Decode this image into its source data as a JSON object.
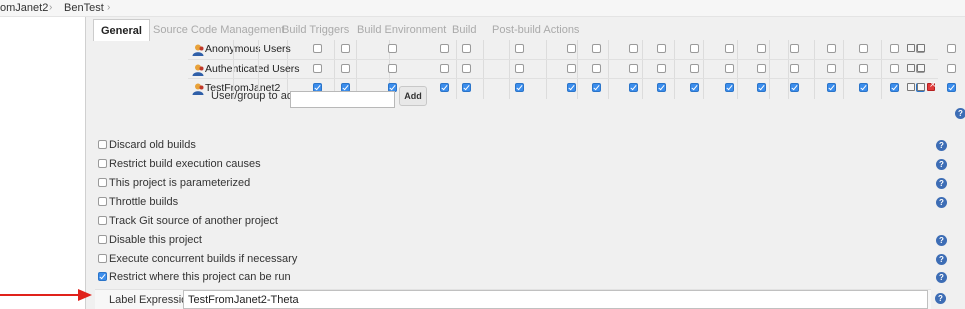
{
  "breadcrumb": {
    "items": [
      "omJanet2",
      "BenTest"
    ],
    "separator": "›"
  },
  "tabs": [
    {
      "label": "General",
      "active": true
    },
    {
      "label": "Source Code Management",
      "active": false
    },
    {
      "label": "Build Triggers",
      "active": false
    },
    {
      "label": "Build Environment",
      "active": false
    },
    {
      "label": "Build",
      "active": false
    },
    {
      "label": "Post-build Actions",
      "active": false
    }
  ],
  "permissions": {
    "rows": [
      {
        "name": "Anonymous Users",
        "checked": [
          false,
          false,
          false,
          false,
          false,
          false,
          false,
          false,
          false,
          false,
          false,
          false,
          false,
          false,
          false,
          false,
          false,
          false,
          false,
          false
        ],
        "actions": [
          "select-all-icon",
          "unselect-all-icon"
        ]
      },
      {
        "name": "Authenticated Users",
        "checked": [
          false,
          false,
          false,
          false,
          false,
          false,
          false,
          false,
          false,
          false,
          false,
          false,
          false,
          false,
          false,
          false,
          false,
          false,
          false,
          false
        ],
        "actions": [
          "select-all-icon",
          "unselect-all-icon"
        ]
      },
      {
        "name": "TestFromJanet2",
        "checked": [
          true,
          true,
          true,
          true,
          true,
          true,
          true,
          true,
          true,
          true,
          true,
          true,
          true,
          true,
          true,
          true,
          true,
          true,
          true,
          true
        ],
        "actions": [
          "select-all-icon",
          "unselect-all-icon",
          "delete-icon"
        ]
      }
    ],
    "add_label": "User/group to add:",
    "add_input_value": "",
    "add_button_label": "Add"
  },
  "options": [
    {
      "label": "Discard old builds",
      "checked": false,
      "help": true
    },
    {
      "label": "Restrict build execution causes",
      "checked": false,
      "help": true
    },
    {
      "label": "This project is parameterized",
      "checked": false,
      "help": true
    },
    {
      "label": "Throttle builds",
      "checked": false,
      "help": true
    },
    {
      "label": "Track Git source of another project",
      "checked": false,
      "help": false
    },
    {
      "label": "Disable this project",
      "checked": false,
      "help": true
    },
    {
      "label": "Execute concurrent builds if necessary",
      "checked": false,
      "help": true
    },
    {
      "label": "Restrict where this project can be run",
      "checked": true,
      "help": true
    }
  ],
  "label_expression": {
    "label": "Label Expression",
    "value": "TestFromJanet2-Theta"
  },
  "colors": {
    "checkbox_checked": "#3b8dec",
    "help_icon": "#3d6db5",
    "annotation_arrow": "#e0221b",
    "delete_icon": "#e03a3a"
  }
}
